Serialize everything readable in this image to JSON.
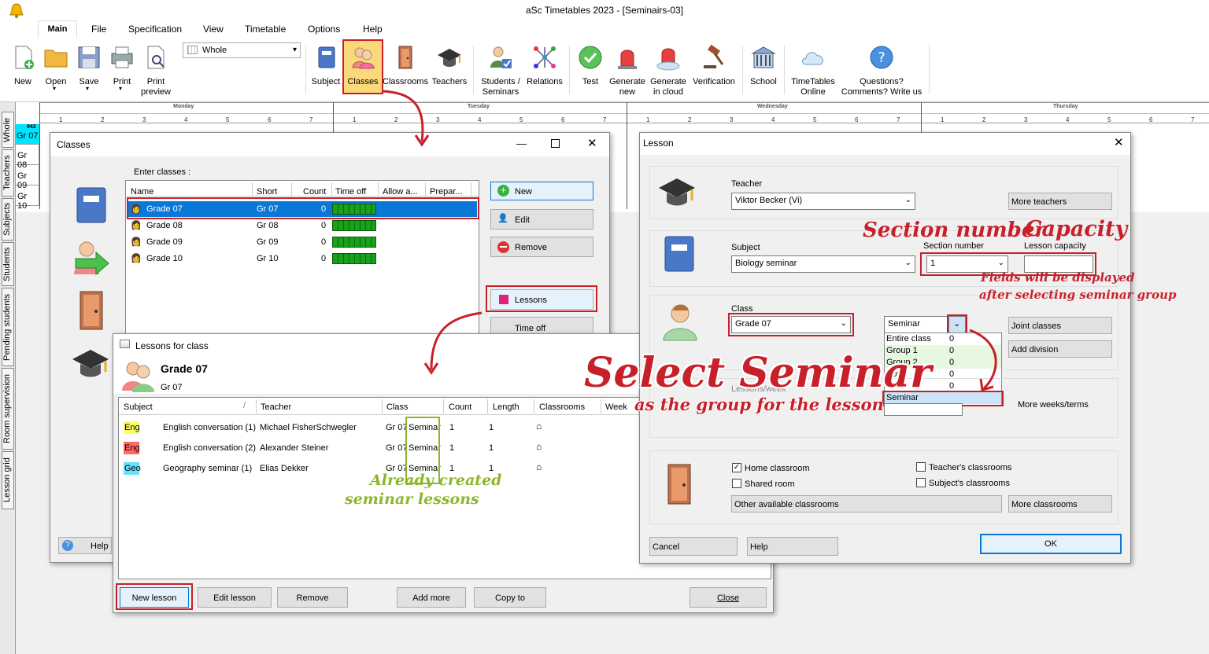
{
  "app": {
    "title": "aSc Timetables 2023  - [Seminairs-03]"
  },
  "menu": [
    "Main",
    "File",
    "Specification",
    "View",
    "Timetable",
    "Options",
    "Help"
  ],
  "ribbon": {
    "whole_value": "Whole",
    "buttons": [
      {
        "label": "New"
      },
      {
        "label": "Open"
      },
      {
        "label": "Save"
      },
      {
        "label": "Print"
      },
      {
        "label": "Print\npreview"
      },
      {
        "label": "Subject"
      },
      {
        "label": "Classes"
      },
      {
        "label": "Classrooms"
      },
      {
        "label": "Teachers"
      },
      {
        "label": "Students /\nSeminars"
      },
      {
        "label": "Relations"
      },
      {
        "label": "Test"
      },
      {
        "label": "Generate\nnew"
      },
      {
        "label": "Generate\nin cloud"
      },
      {
        "label": "Verification"
      },
      {
        "label": "School"
      },
      {
        "label": "TimeTables\nOnline"
      },
      {
        "label": "Questions?\nComments? Write us"
      }
    ]
  },
  "sidetabs": [
    "Whole",
    "Teachers",
    "Subjects",
    "Students",
    "Pending students",
    "Room supervision",
    "Lesson grid"
  ],
  "grid": {
    "days": [
      "Monday",
      "Tuesday",
      "Wednesday",
      "Thursday"
    ],
    "periods": [
      "1",
      "2",
      "3",
      "4",
      "5",
      "6",
      "7"
    ],
    "rows": [
      "Gr 07",
      "Gr 08",
      "Gr 09",
      "Gr 10"
    ],
    "badge": "942"
  },
  "classes_window": {
    "title": "Classes",
    "enter_label": "Enter classes :",
    "columns": [
      "Name",
      "Short",
      "Count",
      "Time off",
      "Allow a...",
      "Prepar..."
    ],
    "rows": [
      {
        "name": "Grade 07",
        "short": "Gr 07",
        "count": "0"
      },
      {
        "name": "Grade 08",
        "short": "Gr 08",
        "count": "0"
      },
      {
        "name": "Grade 09",
        "short": "Gr 09",
        "count": "0"
      },
      {
        "name": "Grade 10",
        "short": "Gr 10",
        "count": "0"
      }
    ],
    "btn_new": "New",
    "btn_edit": "Edit",
    "btn_remove": "Remove",
    "btn_lessons": "Lessons",
    "btn_timeoff": "Time off",
    "btn_help": "Help"
  },
  "lessons_window": {
    "title": "Lessons for class",
    "class_name": "Grade 07",
    "class_short": "Gr 07",
    "columns": [
      "Subject",
      "Teacher",
      "Class",
      "Count",
      "Length",
      "Classrooms",
      "Week"
    ],
    "rows": [
      {
        "tag": "Eng",
        "tag_color": "#ffff66",
        "subject": "English conversation (1)",
        "teacher": "Michael FisherSchwegler",
        "class": "Gr 07",
        "group": "Seminar",
        "count": "1",
        "length": "1"
      },
      {
        "tag": "Eng",
        "tag_color": "#ff6b6b",
        "subject": "English conversation (2)",
        "teacher": "Alexander Steiner",
        "class": "Gr 07",
        "group": "Seminar",
        "count": "1",
        "length": "1"
      },
      {
        "tag": "Geo",
        "tag_color": "#66e0ff",
        "subject": "Geography seminar (1)",
        "teacher": "Elias Dekker",
        "class": "Gr 07",
        "group": "Seminar",
        "count": "1",
        "length": "1"
      }
    ],
    "btn_new": "New lesson",
    "btn_edit": "Edit lesson",
    "btn_remove": "Remove",
    "btn_addmore": "Add more",
    "btn_copy": "Copy to",
    "btn_close": "Close"
  },
  "lesson_dialog": {
    "title": "Lesson",
    "teacher_label": "Teacher",
    "teacher_value": "Viktor Becker (Vi)",
    "more_teachers": "More teachers",
    "subject_label": "Subject",
    "subject_value": "Biology seminar",
    "section_label": "Section number",
    "section_value": "1",
    "capacity_label": "Lesson capacity",
    "class_label": "Class",
    "class_value": "Grade 07",
    "group_value": "Seminar",
    "groups": [
      {
        "name": "Entire class",
        "count": "0"
      },
      {
        "name": "Group 1",
        "count": "0"
      },
      {
        "name": "Group 2",
        "count": "0"
      },
      {
        "name": "Boys",
        "count": "0"
      },
      {
        "name": "Girls",
        "count": "0"
      },
      {
        "name": "Seminar",
        "count": ""
      }
    ],
    "joint_classes": "Joint classes",
    "add_division": "Add division",
    "lessons_week_label": "Lessons/week",
    "more_weeks": "More weeks/terms",
    "home_classroom": "Home classroom",
    "shared_room": "Shared room",
    "teachers_classrooms": "Teacher's classrooms",
    "subjects_classrooms": "Subject's classrooms",
    "other_classrooms": "Other available classrooms",
    "more_classrooms": "More classrooms",
    "cancel": "Cancel",
    "help": "Help",
    "ok": "OK"
  },
  "annotations": {
    "section_number": "Section number",
    "capacity": "Capacity",
    "fields_note_1": "Fields will be displayed",
    "fields_note_2": "after selecting seminar group",
    "select_seminar": "Select Seminar",
    "as_group": "as the group for the lesson",
    "already_1": "Already created",
    "already_2": "seminar lessons"
  }
}
